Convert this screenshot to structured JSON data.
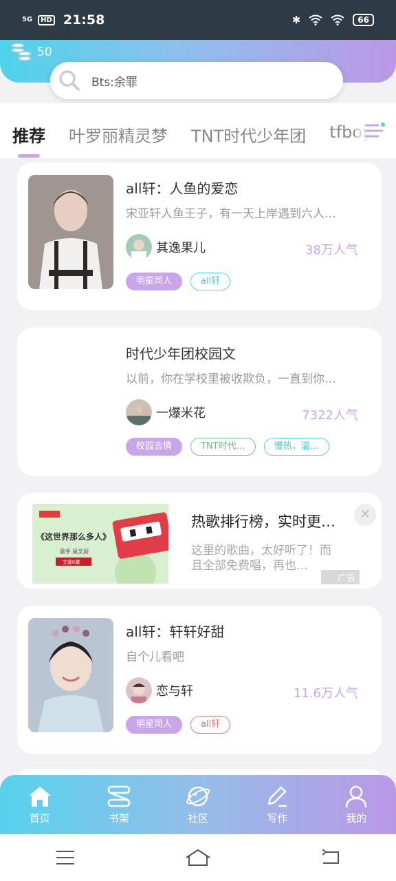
{
  "status_bar": {
    "signal": "5G",
    "hd": "HD",
    "time": "21:58",
    "battery": "66"
  },
  "header": {
    "coins": "50"
  },
  "search": {
    "placeholder": "Bts:余罪"
  },
  "tabs": [
    "推荐",
    "叶罗丽精灵梦",
    "TNT时代少年团",
    "tfboys"
  ],
  "cards": [
    {
      "title": "all轩：人鱼的爱恋",
      "desc": "宋亚轩人鱼王子，有一天上岸遇到六人…",
      "author": "其逸果儿",
      "popularity": "38万人气",
      "tags": [
        "明星同人",
        "all轩"
      ]
    },
    {
      "title": "时代少年团校园文",
      "desc": "以前，你在学校里被收欺负，一直到你…",
      "author": "一爆米花",
      "popularity": "7322人气",
      "tags": [
        "校园言情",
        "TNT时代…",
        "慢热，温…"
      ]
    },
    {
      "title": "all轩：轩轩好甜",
      "desc": "自个儿看吧",
      "author": "恋与轩",
      "popularity": "11.6万人气",
      "tags": [
        "明星同人",
        "all轩"
      ]
    }
  ],
  "ad": {
    "title": "热歌排行榜，实时更…",
    "desc": "这里的歌曲，太好听了！而且全部免费唱，再也…",
    "label": "广告",
    "close": "✕",
    "banner_text": "《这世界那么多人》",
    "banner_sub": "歌手 莫文蔚",
    "banner_btn": "立即K歌"
  },
  "bottom_nav": [
    "首页",
    "书架",
    "社区",
    "写作",
    "我的"
  ],
  "colors": {
    "accent_purple": "#c9a6ec",
    "accent_cyan": "#4fd3ea",
    "popularity": "#c8a8ea"
  }
}
